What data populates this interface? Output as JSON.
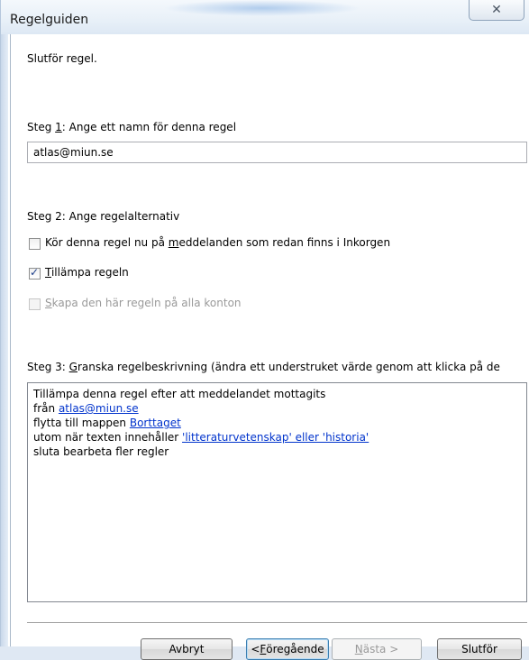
{
  "window": {
    "title": "Regelguiden",
    "close_glyph": "✕",
    "close_icon": "close-icon"
  },
  "header": {
    "subtitle": "Slutför regel."
  },
  "step1": {
    "label_prefix": "Steg ",
    "label_key": "1",
    "label_rest": ": Ange ett namn för denna regel",
    "name_value": "atlas@miun.se"
  },
  "step2": {
    "label": "Steg 2: Ange regelalternativ",
    "options": [
      {
        "before": "Kör denna regel nu på ",
        "key": "m",
        "after": "eddelanden som redan finns i Inkorgen",
        "checked": false,
        "enabled": true
      },
      {
        "before": "",
        "key": "T",
        "after": "illämpa regeln",
        "checked": true,
        "enabled": true
      },
      {
        "before": "",
        "key": "S",
        "after": "kapa den här regeln på alla konton",
        "checked": false,
        "enabled": false
      }
    ]
  },
  "step3": {
    "label_prefix": "Steg 3: ",
    "label_key": "G",
    "label_rest": "ranska regelbeskrivning (ändra ett understruket värde genom att klicka på de",
    "description": {
      "line1": "Tillämpa denna regel efter att meddelandet mottagits",
      "line2_text": "från ",
      "line2_link": "atlas@miun.se",
      "line3_text": "flytta till mappen ",
      "line3_link": "Borttaget",
      "line4_text": "utom när texten innehåller ",
      "line4_link": "'litteraturvetenskap' eller 'historia'",
      "line5": "sluta bearbeta fler regler"
    }
  },
  "buttons": {
    "cancel": "Avbryt",
    "back_prefix": "< ",
    "back_key": "F",
    "back_rest": "öregående",
    "next_key": "N",
    "next_rest": "ästa >",
    "finish": "Slutför"
  }
}
